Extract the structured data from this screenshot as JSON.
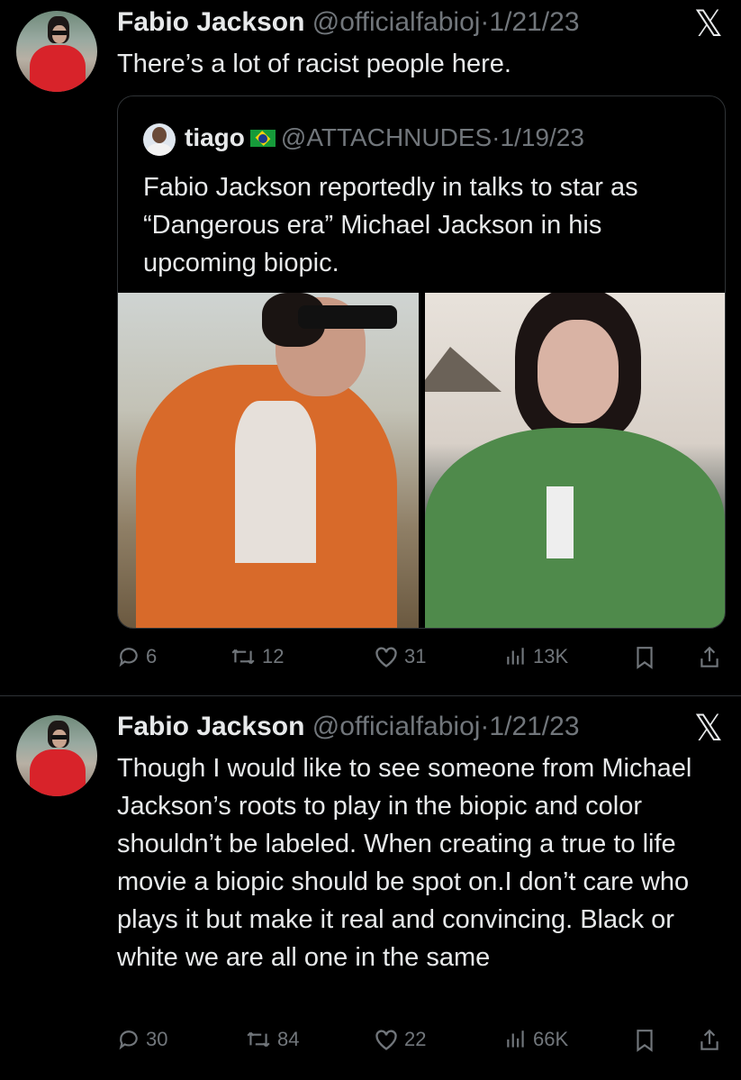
{
  "tweets": [
    {
      "name": "Fabio Jackson",
      "handle": "@officialfabioj",
      "sep": "·",
      "date": "1/21/23",
      "text": "There’s a lot of racist people here.",
      "quote": {
        "name": "tiago",
        "handle": "@ATTACHNUDES",
        "sep": "·",
        "date": "1/19/23",
        "text": "Fabio Jackson reportedly in talks to star as “Dangerous era” Michael Jackson in his upcoming biopic."
      },
      "replies": "6",
      "retweets": "12",
      "likes": "31",
      "views": "13K"
    },
    {
      "name": "Fabio Jackson",
      "handle": "@officialfabioj",
      "sep": "·",
      "date": "1/21/23",
      "text": "Though I would like to see someone from Michael Jackson’s roots to play in the biopic and color shouldn’t be labeled. When creating a true to life movie a biopic should be spot on.I don’t care who plays it but make it real and convincing. Black or white we are all one in the same",
      "replies": "30",
      "retweets": "84",
      "likes": "22",
      "views": "66K"
    }
  ],
  "icons": {
    "x_logo": "𝕏",
    "reply": "reply-icon",
    "retweet": "retweet-icon",
    "like": "heart-icon",
    "views": "views-icon",
    "bookmark": "bookmark-icon",
    "share": "share-icon"
  },
  "colors": {
    "background": "#000000",
    "text": "#e7e9ea",
    "muted": "#71767b",
    "border": "#2f3336"
  }
}
